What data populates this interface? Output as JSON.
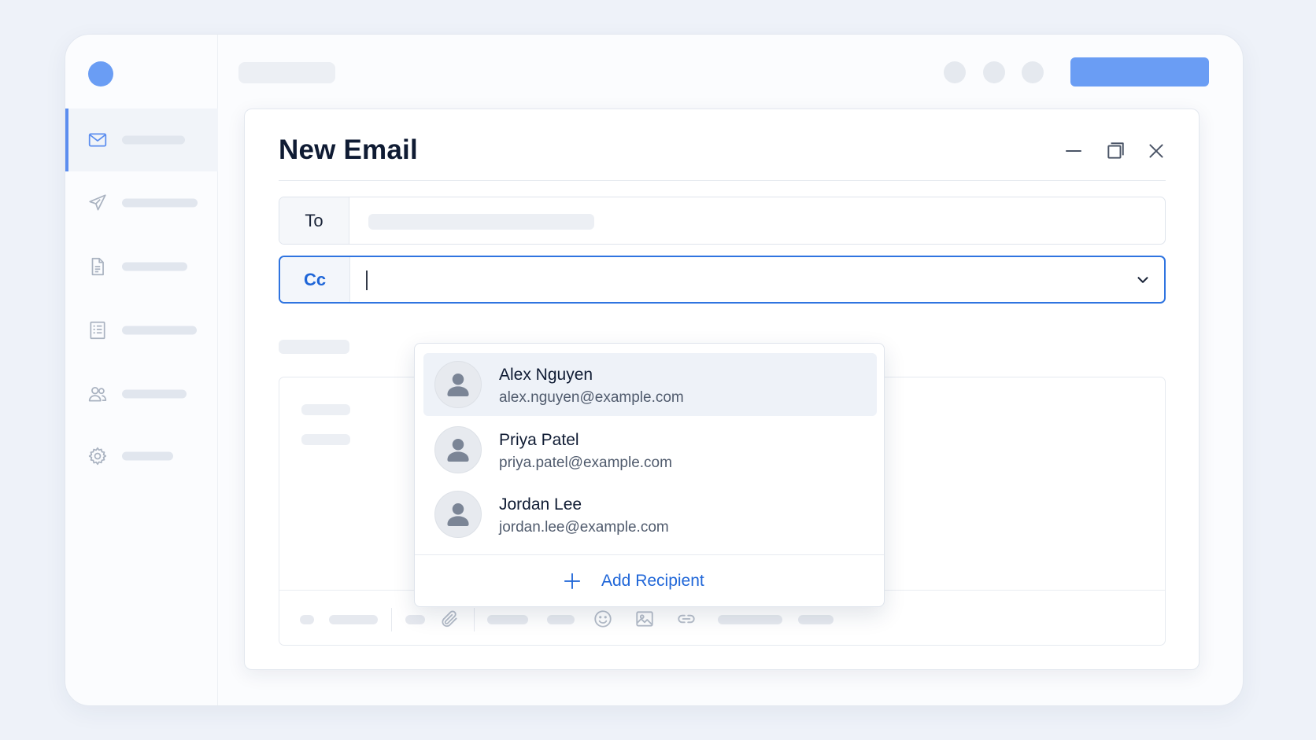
{
  "compose": {
    "title": "New Email",
    "to_label": "To",
    "cc_label": "Cc",
    "cc_value": ""
  },
  "suggestions": [
    {
      "name": "Alex Nguyen",
      "email": "alex.nguyen@example.com",
      "icon": "user-avatar-icon"
    },
    {
      "name": "Priya Patel",
      "email": "priya.patel@example.com",
      "icon": "user-avatar-icon"
    },
    {
      "name": "Jordan Lee",
      "email": "jordan.lee@example.com",
      "icon": "user-avatar-icon"
    }
  ],
  "add_recipient": {
    "label": "Add Recipient",
    "icon": "plus-icon"
  },
  "sidebar_icons": [
    "mail-icon",
    "send-icon",
    "document-icon",
    "list-icon",
    "users-icon",
    "gear-icon"
  ],
  "window_controls": [
    "minimize-icon",
    "maximize-icon",
    "close-icon"
  ],
  "toolbar_icons": [
    "attachment-icon",
    "emoji-icon",
    "image-icon",
    "link-icon"
  ],
  "colors": {
    "accent": "#2f74e0",
    "brand": "#6a9df4",
    "highlight": "#eef2f8"
  }
}
